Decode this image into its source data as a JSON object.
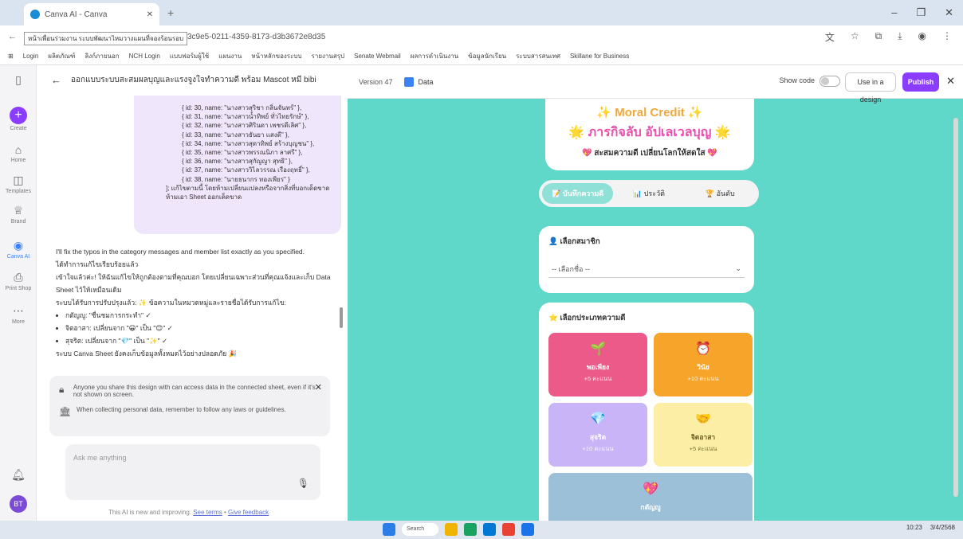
{
  "browser": {
    "tab_title": "Canva AI - Canva",
    "url": "canva.com/ai/code/thread/1d23c9e5-0211-4359-8173-d3b3672e8d35",
    "tooltip": "หน้าเพื่อนร่วมงาน ระบบพัฒนาไหมวางแผนที่จองร้อนรอบ",
    "bookmarks": [
      "Login",
      "ผลิตภัณฑ์",
      "ลิงก์ภายนอก",
      "NCH Login",
      "แบบฟอร์มผู้ใช้",
      "แผนงาน",
      "หน้าหลักของระบบ",
      "รายงานสรุป",
      "Senate Webmail",
      "ผลการดำเนินงาน",
      "ข้อมูลนักเรียน",
      "ระบบสารสนเทศ",
      "Skillane for Business"
    ]
  },
  "rail": {
    "items": [
      "Create",
      "Home",
      "Templates",
      "Brand",
      "Canva AI",
      "Print Shop",
      "More"
    ],
    "avatar": "BT"
  },
  "chat": {
    "title": "ออกแบบระบบสะสมผลบุญและแรงจูงใจทำความดี พร้อม Mascot หมี bibi",
    "code_lines": [
      "{ id: 30, name: \"นางสาวสุริชา กลิ่นจันทร์\" },",
      "{ id: 31, name: \"นางสาวน้ำทิพย์ ทั่วไทยรักษ์\" },",
      "{ id: 32, name: \"นางสาวศิรินดา เพชรดีเลิศ\" },",
      "{ id: 33, name: \"นางสาวธันยา แสงดี\" },",
      "{ id: 34, name: \"นางสาวสุดาทิพย์ สร้างบุญชน\" },",
      "{ id: 35, name: \"นางสาวพรรณนิภา ลาศรี\" },",
      "{ id: 36, name: \"นางสาวสุกัญญา สุทธิ\" },",
      "{ id: 37, name: \"นางสาววิไลวรรณ เรืองฤทธิ์\" },",
      "{ id: 38, name: \"นายธนากร ทองเพียร\" }"
    ],
    "code_footer": "]; แก้ไขตามนี้ โดยห้ามเปลี่ยนแปลงหรือจากสิ่งที่บอกเด็ดขาด ห้ามเอา Sheet ออกเด็ดขาด",
    "reply_1": "I'll fix the typos in the category messages and member list exactly as you specified.",
    "reply_2": "ได้ทำการแก้ไขเรียบร้อยแล้ว",
    "reply_3": "เข้าใจแล้วค่ะ! ให้ฉันแก้ไขให้ถูกต้องตามที่คุณบอก โดยเปลี่ยนเฉพาะส่วนที่คุณแจ้งและเก็บ Data Sheet ไว้ให้เหมือนเดิม",
    "reply_4": "ระบบได้รับการปรับปรุงแล้ว: ✨ ข้อความในหมวดหมู่และรายชื่อได้รับการแก้ไข:",
    "bullets": [
      "กตัญญู: \"ชื่นชมการกระทำ\" ✓",
      "จิตอาสา: เปลี่ยนจาก \"😀\" เป็น \"😊\" ✓",
      "สุจริต: เปลี่ยนจาก \"💎\" เป็น \"✨\" ✓"
    ],
    "reply_5": "ระบบ Canva Sheet ยังคงเก็บข้อมูลทั้งหมดไว้อย่างปลอดภัย 🎉",
    "notice_1": "Anyone you share this design with can access data in the connected sheet, even if it's not shown on screen.",
    "notice_2": "When collecting personal data, remember to follow any laws or guidelines.",
    "input_placeholder": "Ask me anything",
    "disclaimer": "This AI is new and improving.",
    "terms": "See terms",
    "feedback": "Give feedback"
  },
  "preview": {
    "version": "Version 47",
    "data": "Data",
    "show_code": "Show code",
    "use_in_design": "Use in a design",
    "publish": "Publish",
    "hero_1": "✨ Moral Credit ✨",
    "hero_2": "🌟 ภารกิจลับ อัปเลเวลบุญ 🌟",
    "hero_3": "💖 สะสมความดี เปลี่ยนโลกให้สดใส 💖",
    "tabs": [
      "📝 บันทึกความดี",
      "📊 ประวัติ",
      "🏆 อันดับ"
    ],
    "member_label": "👤 เลือกสมาชิก",
    "member_select": "-- เลือกชื่อ --",
    "type_label": "⭐ เลือกประเภทความดี",
    "tiles": [
      {
        "emoji": "🌱",
        "name": "พอเพียง",
        "pts": "+5 คะแนน",
        "color": "#ec5a8a"
      },
      {
        "emoji": "⏰",
        "name": "วินัย",
        "pts": "+10 คะแนน",
        "color": "#f6a52a"
      },
      {
        "emoji": "💎",
        "name": "สุจริต",
        "pts": "+10 คะแนน",
        "color": "#c8b4f6"
      },
      {
        "emoji": "🤝",
        "name": "จิตอาสา",
        "pts": "+5 คะแนน",
        "color": "#fdeea6"
      },
      {
        "emoji": "💖",
        "name": "กตัญญู",
        "pts": "",
        "color": "#9cc0d8"
      }
    ]
  },
  "taskbar": {
    "search": "Search",
    "time": "10:23",
    "date": "3/4/2568"
  }
}
